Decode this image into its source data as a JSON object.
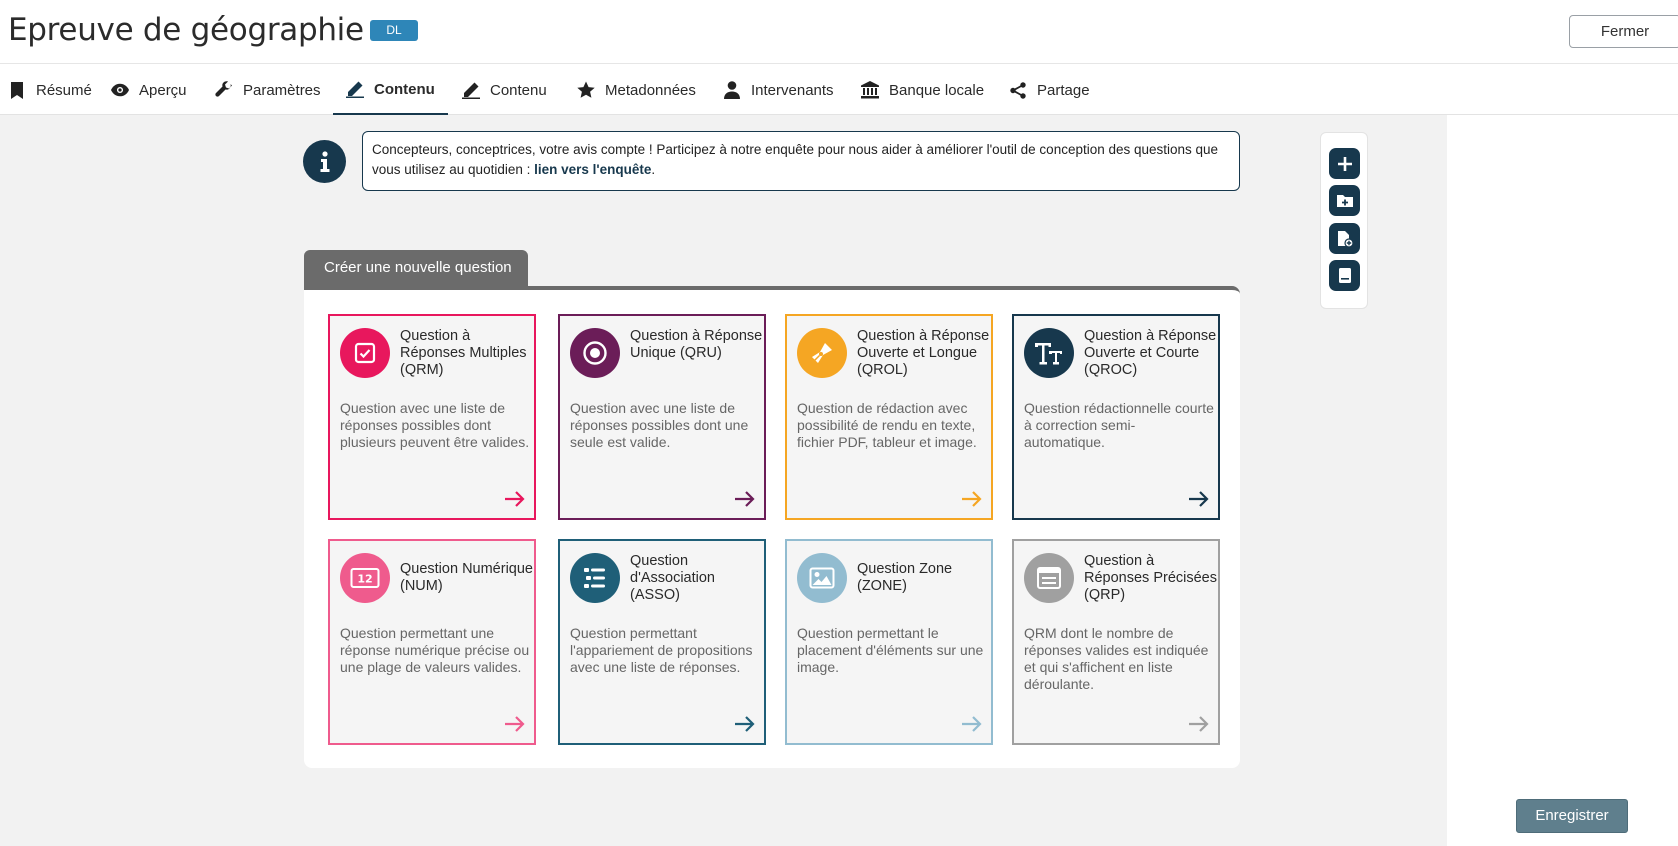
{
  "header": {
    "title": "Epreuve de géographie",
    "badge": "DL",
    "close_label": "Fermer"
  },
  "tabs": [
    {
      "label": "Résumé",
      "icon": "bookmark-icon"
    },
    {
      "label": "Aperçu",
      "icon": "eye-icon"
    },
    {
      "label": "Paramètres",
      "icon": "wrench-icon"
    },
    {
      "label": "Contenu",
      "icon": "pen-icon",
      "active": true
    },
    {
      "label": "Contenu",
      "icon": "pen-icon"
    },
    {
      "label": "Metadonnées",
      "icon": "star-icon"
    },
    {
      "label": "Intervenants",
      "icon": "user-icon"
    },
    {
      "label": "Banque locale",
      "icon": "bank-icon"
    },
    {
      "label": "Partage",
      "icon": "share-icon"
    }
  ],
  "info": {
    "text": "Concepteurs, conceptrices, votre avis compte ! Participez à notre enquête pour nous aider à améliorer l'outil de conception des questions que vous utilisez au quotidien : ",
    "link": "lien vers l'enquête",
    "suffix": "."
  },
  "create": {
    "tab_label": "Créer une nouvelle question",
    "cards": [
      {
        "title": "Question à Réponses Multiples (QRM)",
        "desc": "Question avec une liste de réponses possibles dont plusieurs peuvent être valides.",
        "color": "#e8175d",
        "icon": "checkbox-icon"
      },
      {
        "title": "Question à Réponse Unique (QRU)",
        "desc": "Question avec une liste de réponses possibles dont une seule est valide.",
        "color": "#6b1d58",
        "icon": "radio-icon"
      },
      {
        "title": "Question à Réponse Ouverte et Longue (QROL)",
        "desc": "Question de rédaction avec possibilité de rendu en texte, fichier PDF, tableur et image.",
        "color": "#f5a623",
        "icon": "fountain-pen-icon"
      },
      {
        "title": "Question à Réponse Ouverte et Courte (QROC)",
        "desc": "Question rédactionnelle courte à correction semi-automatique.",
        "color": "#17384d",
        "icon": "text-size-icon"
      },
      {
        "title": "Question Numérique (NUM)",
        "desc": "Question permettant une réponse numérique précise ou une plage de valeurs valides.",
        "color": "#ef5b8d",
        "icon": "number-icon"
      },
      {
        "title": "Question d'Association (ASSO)",
        "desc": "Question permettant l'appariement de propositions avec une liste de réponses.",
        "color": "#1f5f78",
        "icon": "list-icon"
      },
      {
        "title": "Question Zone (ZONE)",
        "desc": "Question permettant le placement d'éléments sur une image.",
        "color": "#92bcd0",
        "icon": "image-icon"
      },
      {
        "title": "Question à Réponses Précisées (QRP)",
        "desc": "QRM dont le nombre de réponses valides est indiquée et qui s'affichent en liste déroulante.",
        "color": "#a0a0a0",
        "icon": "dropdown-list-icon"
      }
    ]
  },
  "toolbar": [
    "add-icon",
    "add-folder-icon",
    "add-file-icon",
    "book-icon"
  ],
  "footer": {
    "save_label": "Enregistrer"
  }
}
